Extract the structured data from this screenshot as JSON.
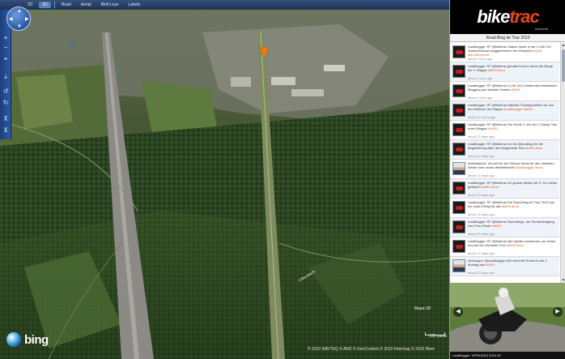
{
  "map": {
    "toolbar": {
      "items": [
        "2D",
        "3D",
        "Road",
        "Aerial",
        "Bird's eye",
        "Labels"
      ],
      "active_index": 1
    },
    "tools": [
      "zoom-in-icon",
      "zoom-out-icon",
      "locate-icon",
      "download-icon",
      "rotate-left-icon",
      "rotate-right-icon",
      "tilt-up-icon",
      "tilt-down-icon"
    ],
    "street_label": "Offenbach",
    "scale_label": "100 yards",
    "copyright": "© 2010 NAVTEQ © AND © GeoContent © 2010 Intermap © 2010 Blom",
    "overview_label": "Mapa 3D",
    "brand": "bing",
    "marker_color": "#f07a16"
  },
  "panel": {
    "brand_bike": "bike",
    "brand_trac": "trac",
    "brand_sub": "motorrad",
    "blog_title": "Road-Blog de Tour 2010",
    "tweets": [
      {
        "avatar": "logo",
        "text": "roadblogger: RT @biketrac Station heute in der X-Life 101 Stottermotivasi weggekommen bei Kilometer",
        "link": "#tdf15 http://bit.ly/tour",
        "meta": "about 1 hour ago"
      },
      {
        "avatar": "logo",
        "text": "roadblogger: RT @biketrac geniale Kurven durch die Berge bei 1. Etappe",
        "link": "#tdf15 #tour",
        "meta": "about 1 hour ago"
      },
      {
        "avatar": "logo",
        "text": "roadblogger: RT @biketrac X-Life 101 Funktioniert fantastisch! Blogging auf nächster Station",
        "link": "#tdf15",
        "meta": "about 1 hour ago"
      },
      {
        "avatar": "logo",
        "text": "roadblogger: RT @biketrac Nächste Sonntag treffen wir uns am Zielfeuer der Etappe",
        "link": "#roadblogger #tdf15",
        "meta": "about 12 hours ago"
      },
      {
        "avatar": "logo",
        "text": "roadblogger: RT @biketrac Die Route 1: Wo der 2 Gänge Tour unter Blogger",
        "link": "#tdf15",
        "meta": "about 12 days ago"
      },
      {
        "avatar": "logo",
        "text": "roadblogger: RT @biketrac Ich bin @tourblog für die Begeisterung über die erfolgreiche Tour",
        "link": "#tdf15 #tour",
        "meta": "about 12 days ago"
      },
      {
        "avatar": "person",
        "text": "tmftekkalove: Ich will bin der Strecke heute für den nächsten Winter eine neuen Wetterbericht",
        "link": "#roadblogger #tour",
        "meta": "about 12 days ago"
      },
      {
        "avatar": "logo",
        "text": "roadblogger: RT @biketrac ich gerade Musik hier 3. Km weiter gefahren",
        "link": "#tdf15 #tour",
        "meta": "about 12 days ago"
      },
      {
        "avatar": "logo",
        "text": "roadblogger: RT @biketrac Die Road-Blog de Tour 2010 war ein voller Erfolg für alle",
        "link": "#tdf15 #tour",
        "meta": "about 12 days ago"
      },
      {
        "avatar": "logo",
        "text": "roadblogger: RT @biketrac Neuerdings, der Sonnenaufgang zum Tour-Finale",
        "link": "#tdf15",
        "meta": "about 12 days ago"
      },
      {
        "avatar": "logo",
        "text": "roadblogger: RT @biketrac Alle wieder zusammen, wir sehen uns auf der nächsten Tour",
        "link": "#tdf15 #tour",
        "meta": "about 12 days ago"
      },
      {
        "avatar": "person",
        "text": "uliobergeo: @roadblogger Wie sieht die Route für die 2. Montag aus",
        "link": "#tdf15",
        "meta": "about 12 days ago"
      }
    ],
    "video_caption": "roadblogger: VIPROADZ 2010 06"
  }
}
